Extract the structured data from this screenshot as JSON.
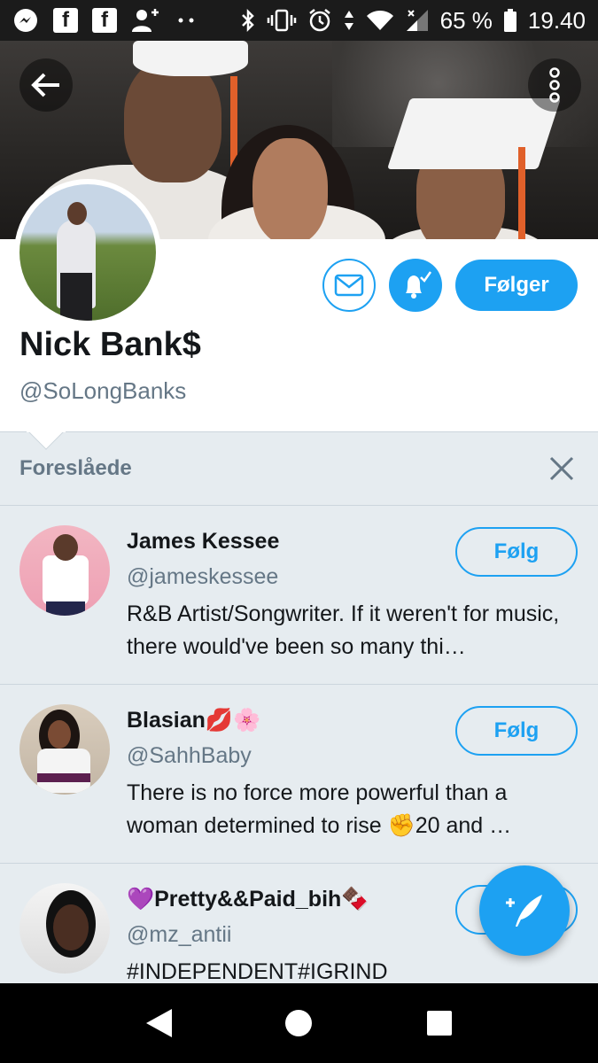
{
  "status_bar": {
    "battery_percent": "65 %",
    "time": "19.40",
    "icons": [
      "messenger-icon",
      "facebook-icon",
      "facebook-icon",
      "add-friend-icon",
      "dots-icon",
      "bluetooth-icon",
      "vibrate-icon",
      "alarm-icon",
      "data-icon",
      "wifi-icon",
      "signal-icon",
      "battery-icon"
    ]
  },
  "header": {
    "back_icon": "arrow-left-icon",
    "more_icon": "more-vertical-icon"
  },
  "profile": {
    "name": "Nick Bank$",
    "handle": "@SoLongBanks",
    "following_label": "Følger",
    "message_icon": "envelope-icon",
    "notify_icon": "bell-icon"
  },
  "suggestions": {
    "title": "Foreslåede",
    "close_icon": "close-icon",
    "items": [
      {
        "name": "James Kessee",
        "handle": "@jameskessee",
        "bio": "R&B Artist/Songwriter. If it weren't for music, there would've been so many thi…",
        "follow_label": "Følg"
      },
      {
        "name": "Blasian💋🌸",
        "handle": "@SahhBaby",
        "bio": "There is no force more powerful than a woman determined to rise ✊20 and …",
        "follow_label": "Følg"
      },
      {
        "name": "💜Pretty&&Paid_bih🍫",
        "handle": "@mz_antii",
        "bio": "#INDEPENDENT#IGRIND",
        "follow_label": "Følg"
      }
    ]
  },
  "fab": {
    "icon": "compose-tweet-icon"
  },
  "nav_bar": {
    "icons": [
      "back-triangle-icon",
      "home-circle-icon",
      "recents-square-icon"
    ]
  },
  "colors": {
    "accent": "#1da1f2",
    "secondary_text": "#657786",
    "panel_bg": "#e6ecf0"
  }
}
